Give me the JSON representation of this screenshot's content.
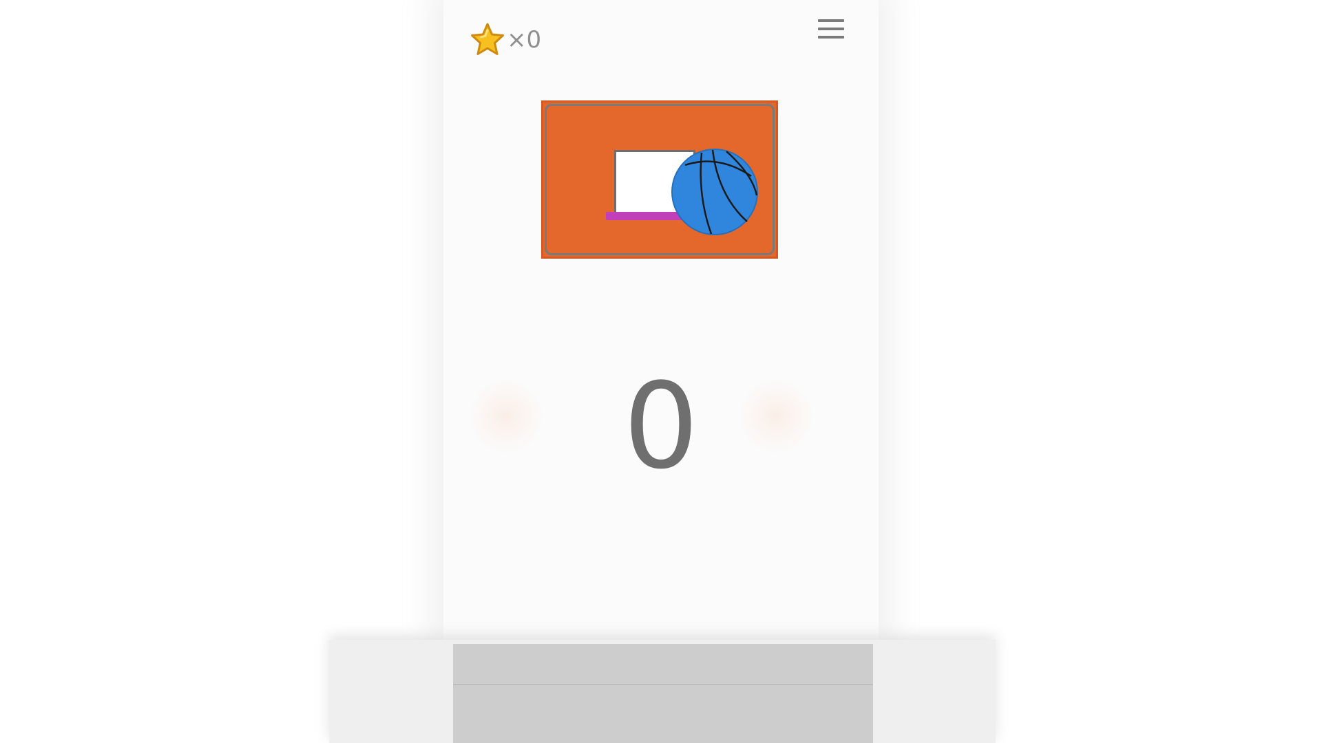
{
  "hud": {
    "star_icon": "star-icon",
    "star_count": "×0",
    "menu_icon": "hamburger-menu-icon"
  },
  "game": {
    "score": "0",
    "backboard_color": "#e4672b",
    "rim_color": "#c13fb9",
    "ball_color": "#2f86dc",
    "ball_icon": "basketball-icon"
  }
}
